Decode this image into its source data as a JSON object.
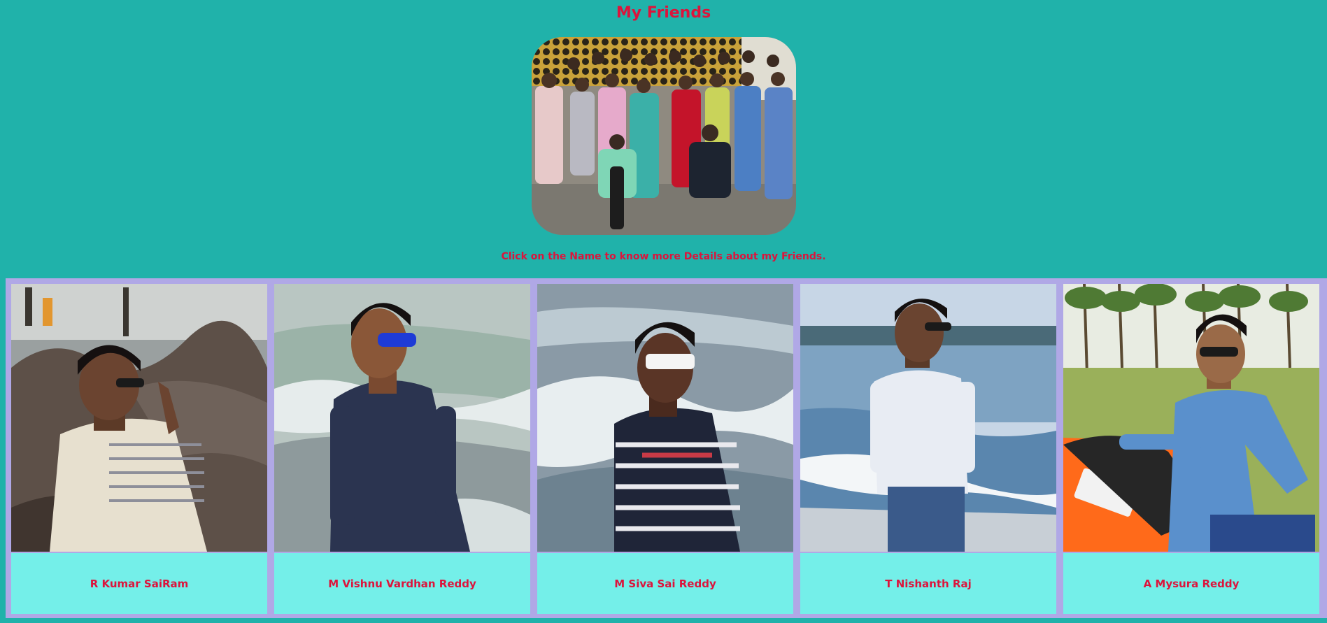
{
  "page": {
    "title": "My Friends",
    "instructions": "Click on the Name to know more Details about my Friends."
  },
  "colors": {
    "background": "#20b2aa",
    "accent": "#dc143c",
    "grid_background": "#b0a8e6",
    "name_box": "#74efe9"
  },
  "friends": [
    {
      "name": "R Kumar SaiRam"
    },
    {
      "name": "M Vishnu Vardhan Reddy"
    },
    {
      "name": "M Siva Sai Reddy"
    },
    {
      "name": "T Nishanth Raj"
    },
    {
      "name": "A Mysura Reddy"
    }
  ]
}
